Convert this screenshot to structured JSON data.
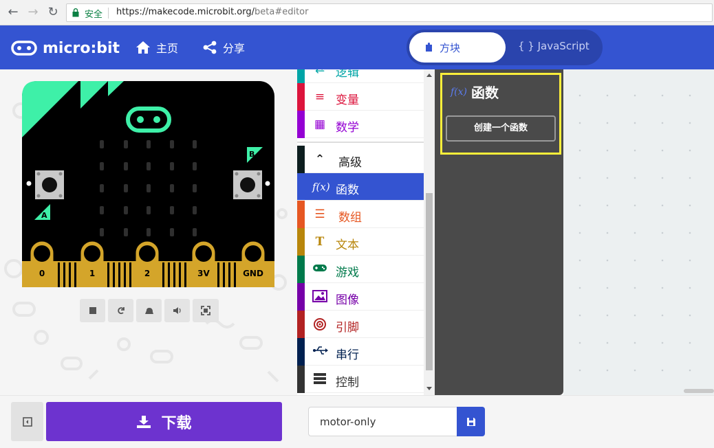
{
  "browser": {
    "secure_label": "安全",
    "url_main": "https://makecode.microbit.org/",
    "url_rest": "beta#editor"
  },
  "header": {
    "logo_text": "micro:bit",
    "home_label": "主页",
    "share_label": "分享",
    "blocks_label": "方块",
    "javascript_label": "{ } JavaScript"
  },
  "board": {
    "button_a": "A",
    "button_b": "B",
    "pins": [
      "0",
      "1",
      "2",
      "3V",
      "GND"
    ]
  },
  "toolbox": {
    "categories": [
      {
        "label": "逻辑",
        "color": "#00a4a6",
        "icon": "logic-icon"
      },
      {
        "label": "变量",
        "color": "#dc143c",
        "icon": "variables-icon"
      },
      {
        "label": "数学",
        "color": "#9400d3",
        "icon": "math-icon"
      },
      {
        "label": "高级",
        "color": "#0d1e1f",
        "icon": "chevron-up-icon"
      },
      {
        "label": "函数",
        "color": "#3455db",
        "icon": "function-icon"
      },
      {
        "label": "数组",
        "color": "#e65722",
        "icon": "array-icon"
      },
      {
        "label": "文本",
        "color": "#b8860b",
        "icon": "text-icon"
      },
      {
        "label": "游戏",
        "color": "#007a4b",
        "icon": "gamepad-icon"
      },
      {
        "label": "图像",
        "color": "#7600a8",
        "icon": "image-icon"
      },
      {
        "label": "引脚",
        "color": "#b22222",
        "icon": "pins-icon"
      },
      {
        "label": "串行",
        "color": "#002050",
        "icon": "usb-icon"
      },
      {
        "label": "控制",
        "color": "#333333",
        "icon": "control-icon"
      }
    ]
  },
  "flyout": {
    "title": "函数",
    "create_button": "创建一个函数"
  },
  "bottom": {
    "download_label": "下载",
    "project_name": "motor-only"
  }
}
